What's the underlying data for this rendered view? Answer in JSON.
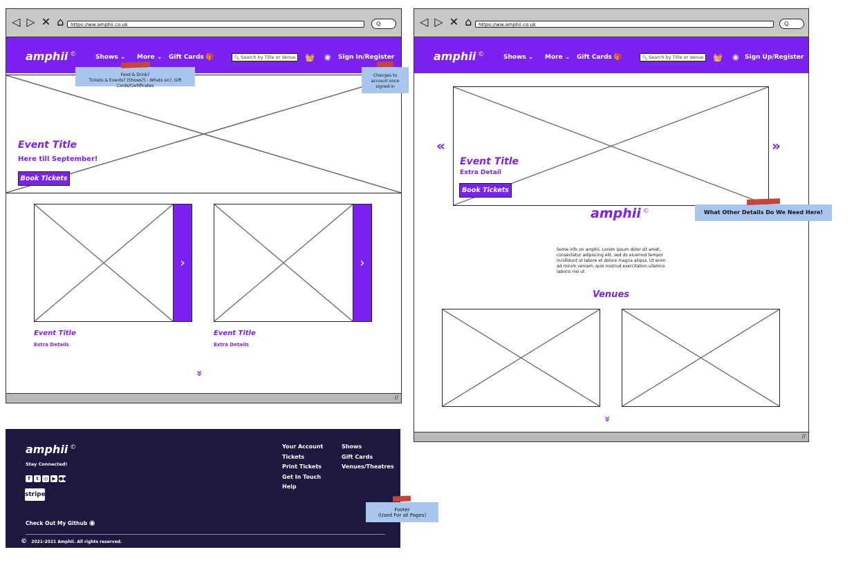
{
  "browser": {
    "url": "https://ww.amphii.co.uk",
    "search_btn": "Q",
    "nav_icons": "◁ ▷ ✕ ⌂"
  },
  "brand": {
    "name": "amphii",
    "mark": "©"
  },
  "nav": {
    "shows": "Shows ⌄",
    "more": "More ⌄",
    "gift_cards": "Gift Cards",
    "gift_icon": "gift-icon",
    "search_placeholder": "Search by Title or Venue",
    "sign_in_left": "Sign In/Register",
    "sign_in_right": "Sign Up/Register"
  },
  "notes": {
    "more_menu_line1": "Food & Drink?",
    "more_menu_line2": "Tickets & Events? (Shows?) - Whats on?, Gift Cards/Certificates",
    "account_line1": "Changes to",
    "account_line2": "account once",
    "account_line3": "signed in",
    "other_details": "What Other Details Do We Need Here!",
    "footer_line1": "Footer",
    "footer_line2": "(Used For all Pages)"
  },
  "left_page": {
    "hero_title": "Event Title",
    "hero_sub": "Here till September!",
    "hero_button": "Book Tickets",
    "cards": [
      {
        "title": "Event Title",
        "detail": "Extra Details"
      },
      {
        "title": "Event Title",
        "detail": "Extra Details"
      }
    ],
    "scroll_more": "⌄⌄"
  },
  "right_page": {
    "hero_title": "Event Title",
    "hero_sub": "Extra Detail",
    "hero_button": "Book Tickets",
    "prev": "«",
    "next": "»",
    "about_text": "Some info on amphii. Lorem ipsum dolor sit amet, consectetur adipiscing elit, sed do eiusmod tempor incididunt ut labore et dolore magna aliqua. Ut enim ad minim veniam, quis nostrud exercitation ullamco laboris nisi ut",
    "venues_heading": "Venues",
    "scroll_more": "⌄⌄"
  },
  "footer": {
    "stay_connected": "Stay Connected!",
    "social": [
      "f",
      "t",
      "◎",
      "▶",
      "●●"
    ],
    "stripe": "stripe",
    "github": "Check Out My Github",
    "copyright_mark": "©",
    "copyright": "2021-2021 Amphii. All rights reserved.",
    "col1": [
      "Your Account",
      "Tickets",
      "Print Tickets",
      "Get In Touch",
      "Help"
    ],
    "col2": [
      "Shows",
      "Gift Cards",
      "Venues/Theatres"
    ]
  },
  "colors": {
    "accent": "#7c22f0",
    "footer_bg": "#1c1840",
    "note": "#a9c6ef",
    "tape": "#c6443a"
  }
}
